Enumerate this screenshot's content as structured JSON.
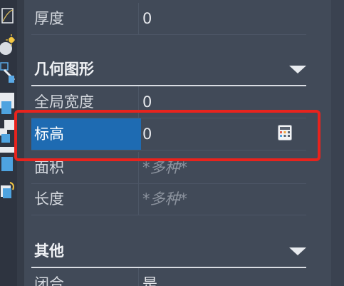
{
  "colors": {
    "panel_bg": "#414a58",
    "selected_bg": "#1e6bb2",
    "highlight_border": "#e8231d",
    "multi_value_text": "#8d949f"
  },
  "rows_top": [
    {
      "label": "厚度",
      "value": "0"
    }
  ],
  "section_geometry": {
    "title": "几何图形",
    "toggle_icon": "chevron-down-icon",
    "rows": [
      {
        "label": "全局宽度",
        "value": "0",
        "selected": false
      },
      {
        "label": "标高",
        "value": "0",
        "selected": true,
        "icon": "calculator-icon"
      },
      {
        "label": "面积",
        "value": "*多种*",
        "selected": false
      },
      {
        "label": "长度",
        "value": "*多种*",
        "selected": false
      }
    ]
  },
  "section_other": {
    "title": "其他",
    "toggle_icon": "chevron-down-icon",
    "rows": [
      {
        "label": "闭合",
        "value": "是"
      }
    ]
  },
  "toolstrip": {
    "icons": [
      "rectangle-icon",
      "sun-icon",
      "paint-icon",
      "blocks-icon",
      "undo-icon"
    ]
  }
}
